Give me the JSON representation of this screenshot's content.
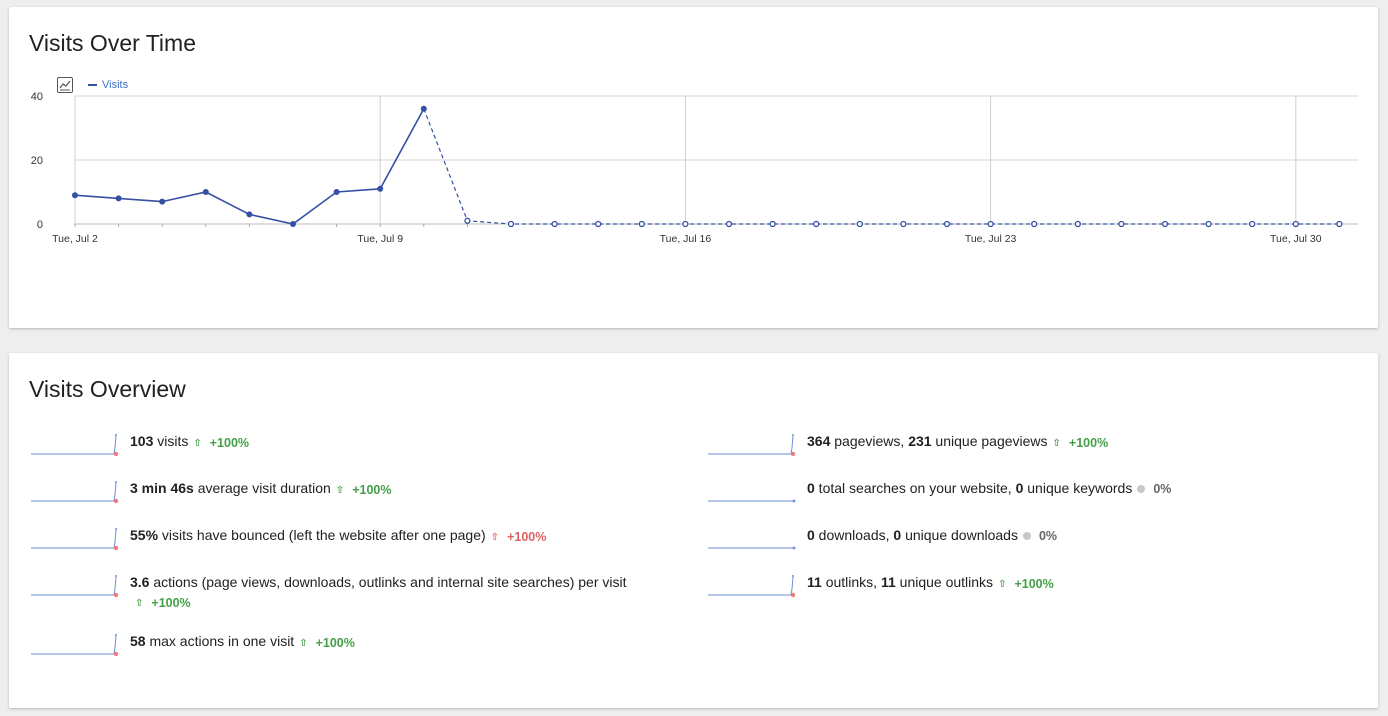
{
  "visits_over_time": {
    "title": "Visits Over Time",
    "chart_toggle_icon": "line-chart-icon",
    "chart_data": {
      "type": "line",
      "title": "",
      "xlabel": "",
      "ylabel": "",
      "ylim": [
        0,
        40
      ],
      "y_ticks": [
        "0",
        "20",
        "40"
      ],
      "x_tick_labels": [
        {
          "index": 0,
          "label": "Tue, Jul 2"
        },
        {
          "index": 7,
          "label": "Tue, Jul 9"
        },
        {
          "index": 14,
          "label": "Tue, Jul 16"
        },
        {
          "index": 21,
          "label": "Tue, Jul 23"
        },
        {
          "index": 28,
          "label": "Tue, Jul 30"
        }
      ],
      "categories": [
        "Jul 2",
        "Jul 3",
        "Jul 4",
        "Jul 5",
        "Jul 6",
        "Jul 7",
        "Jul 8",
        "Jul 9",
        "Jul 10",
        "Jul 11",
        "Jul 12",
        "Jul 13",
        "Jul 14",
        "Jul 15",
        "Jul 16",
        "Jul 17",
        "Jul 18",
        "Jul 19",
        "Jul 20",
        "Jul 21",
        "Jul 22",
        "Jul 23",
        "Jul 24",
        "Jul 25",
        "Jul 26",
        "Jul 27",
        "Jul 28",
        "Jul 29",
        "Jul 30",
        "Jul 31"
      ],
      "series": [
        {
          "name": "Visits",
          "color": "#3450a3",
          "values": [
            9,
            8,
            7,
            10,
            3,
            0,
            10,
            11,
            36,
            1,
            0,
            0,
            0,
            0,
            0,
            0,
            0,
            0,
            0,
            0,
            0,
            0,
            0,
            0,
            0,
            0,
            0,
            0,
            0,
            0
          ],
          "solid_until_index": 8
        }
      ],
      "grid": true,
      "legend_position": "top-left"
    }
  },
  "visits_overview": {
    "title": "Visits Overview",
    "colors": {
      "up": "#43a047",
      "bad": "#e06060",
      "neutral": "#666666",
      "sparkline": "#6a8fd6",
      "sparkline_end": "#f27a7a"
    },
    "left_metrics": [
      {
        "value1": "103",
        "text1": " visits",
        "trend": "+100%",
        "trend_type": "up",
        "trend_icon": "arrow-up-icon"
      },
      {
        "value1": "3 min 46s",
        "text1": " average visit duration",
        "trend": "+100%",
        "trend_type": "up",
        "trend_icon": "arrow-up-icon"
      },
      {
        "value1": "55%",
        "text1": " visits have bounced (left the website after one page)",
        "trend": "+100%",
        "trend_type": "down-bad",
        "trend_icon": "arrow-up-icon"
      },
      {
        "value1": "3.6",
        "text1": " actions (page views, downloads, outlinks and internal site searches) per visit",
        "trend": "+100%",
        "trend_type": "up",
        "trend_icon": "arrow-up-icon"
      },
      {
        "value1": "58",
        "text1": " max actions in one visit",
        "trend": "+100%",
        "trend_type": "up",
        "trend_icon": "arrow-up-icon"
      }
    ],
    "right_metrics": [
      {
        "value1": "364",
        "text1": " pageviews, ",
        "value2": "231",
        "text2": " unique pageviews",
        "trend": "+100%",
        "trend_type": "up",
        "trend_icon": "arrow-up-icon"
      },
      {
        "value1": "0",
        "text1": " total searches on your website, ",
        "value2": "0",
        "text2": " unique keywords",
        "trend": "0%",
        "trend_type": "neutral",
        "trend_icon": "neutral-dot-icon"
      },
      {
        "value1": "0",
        "text1": " downloads, ",
        "value2": "0",
        "text2": " unique downloads",
        "trend": "0%",
        "trend_type": "neutral",
        "trend_icon": "neutral-dot-icon"
      },
      {
        "value1": "11",
        "text1": " outlinks, ",
        "value2": "11",
        "text2": " unique outlinks",
        "trend": "+100%",
        "trend_type": "up",
        "trend_icon": "arrow-up-icon"
      }
    ]
  }
}
